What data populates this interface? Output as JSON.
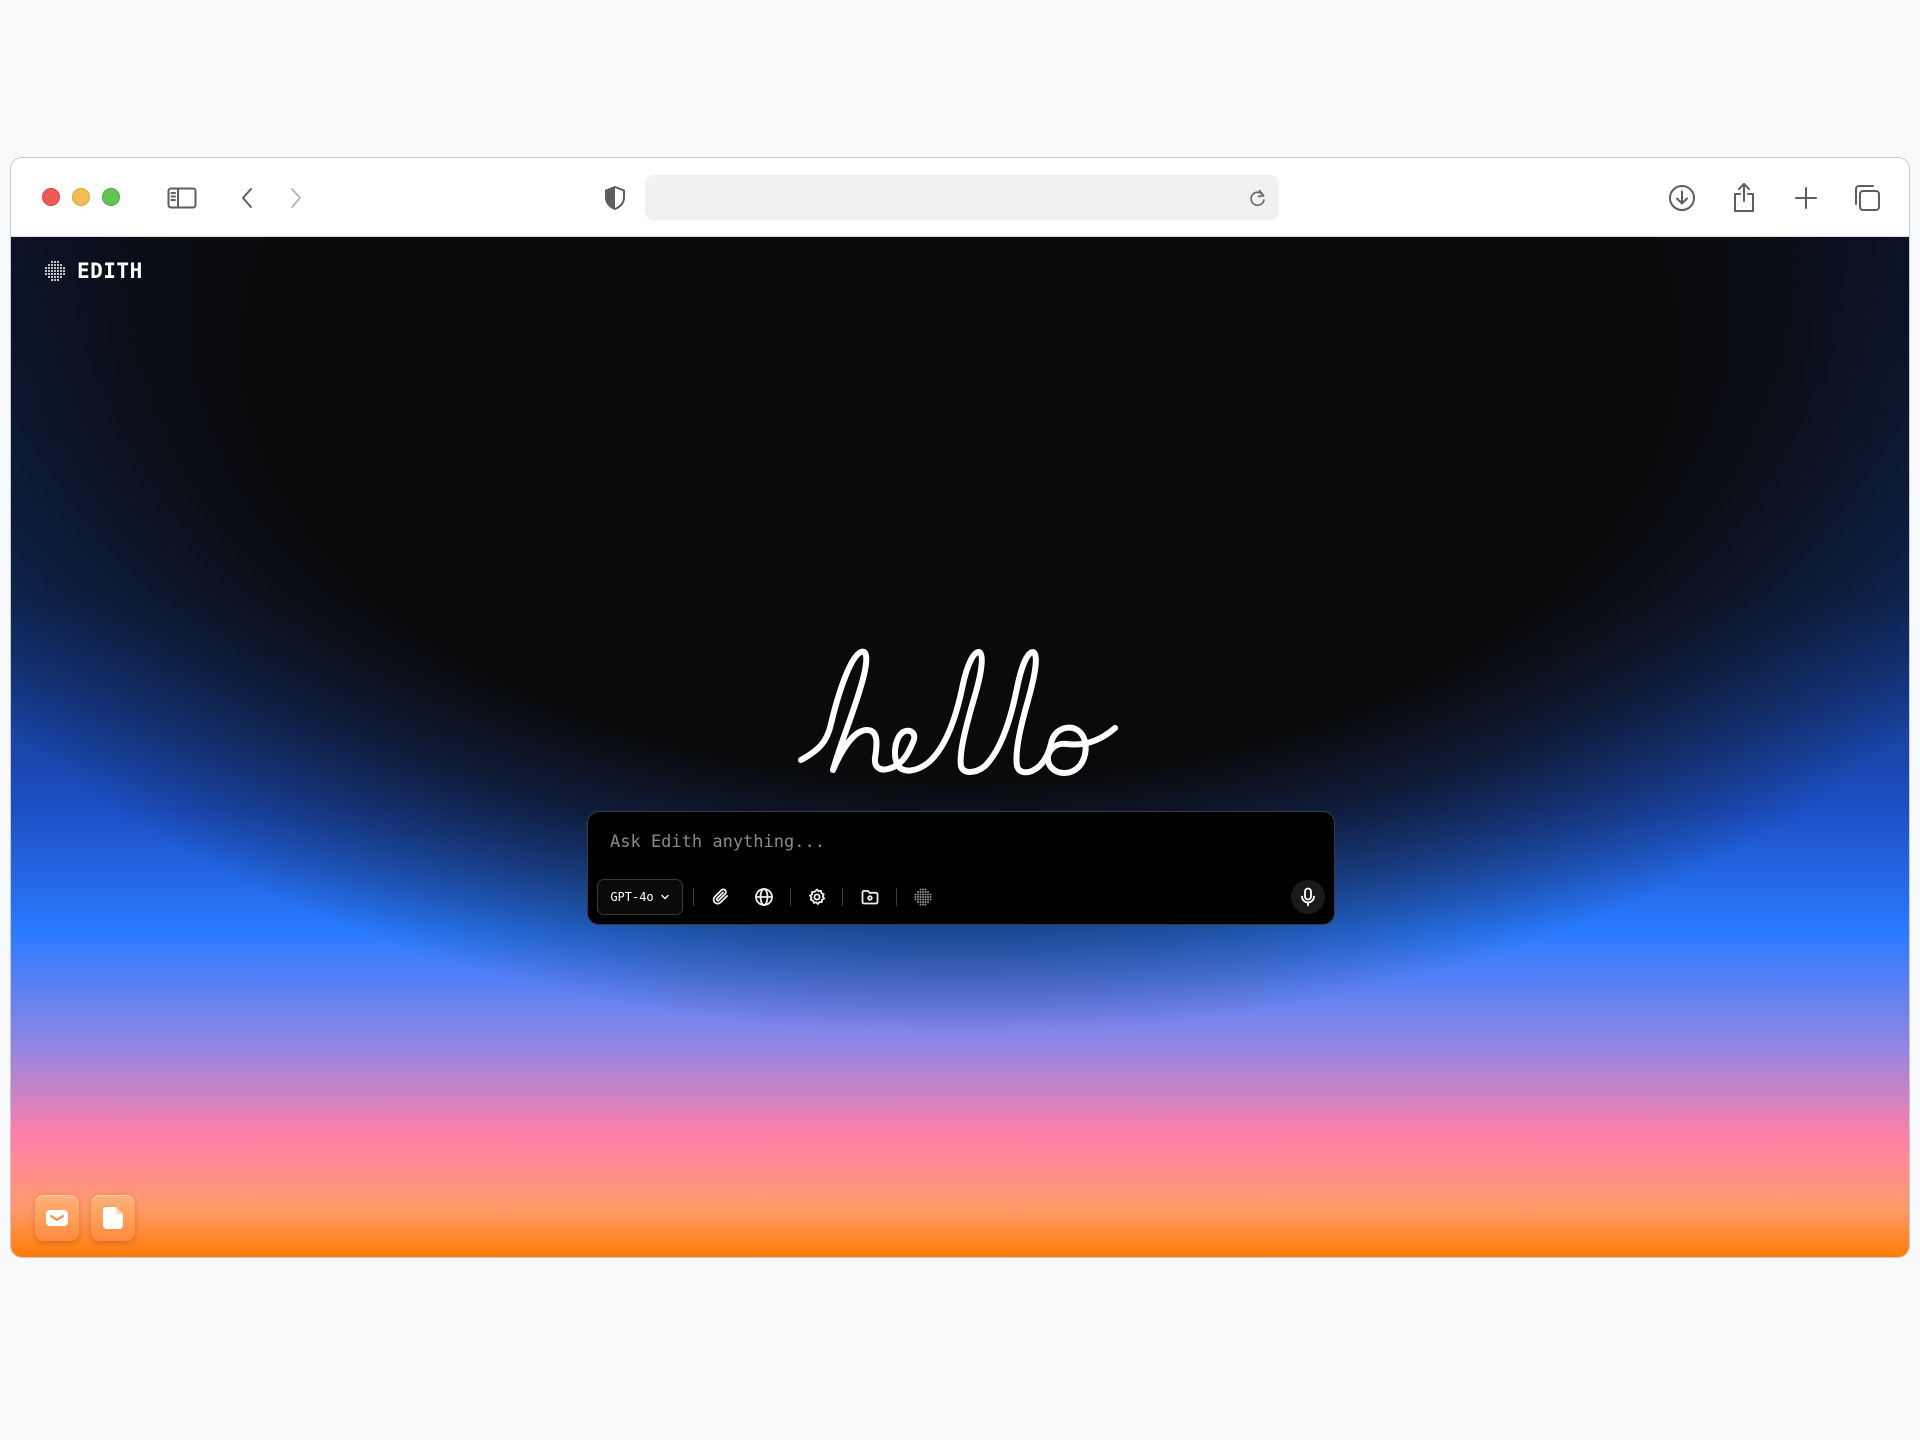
{
  "browser": {
    "address_value": "",
    "icons": [
      "sidebar-icon",
      "back-icon",
      "forward-icon",
      "shield-icon",
      "reload-icon",
      "download-icon",
      "share-icon",
      "new-tab-icon",
      "tab-overview-icon"
    ]
  },
  "app": {
    "brand_name": "EDITH",
    "hero_text": "hello",
    "prompt": {
      "placeholder": "Ask Edith anything...",
      "value": "",
      "model": "GPT-4o"
    },
    "dock": [
      "mail-icon",
      "notes-icon"
    ]
  },
  "colors": {
    "background_dark": "#0a0a0b",
    "gradient_blue": "#2a7bff",
    "gradient_pink": "#ff7fa8",
    "gradient_orange": "#ff7a00"
  }
}
